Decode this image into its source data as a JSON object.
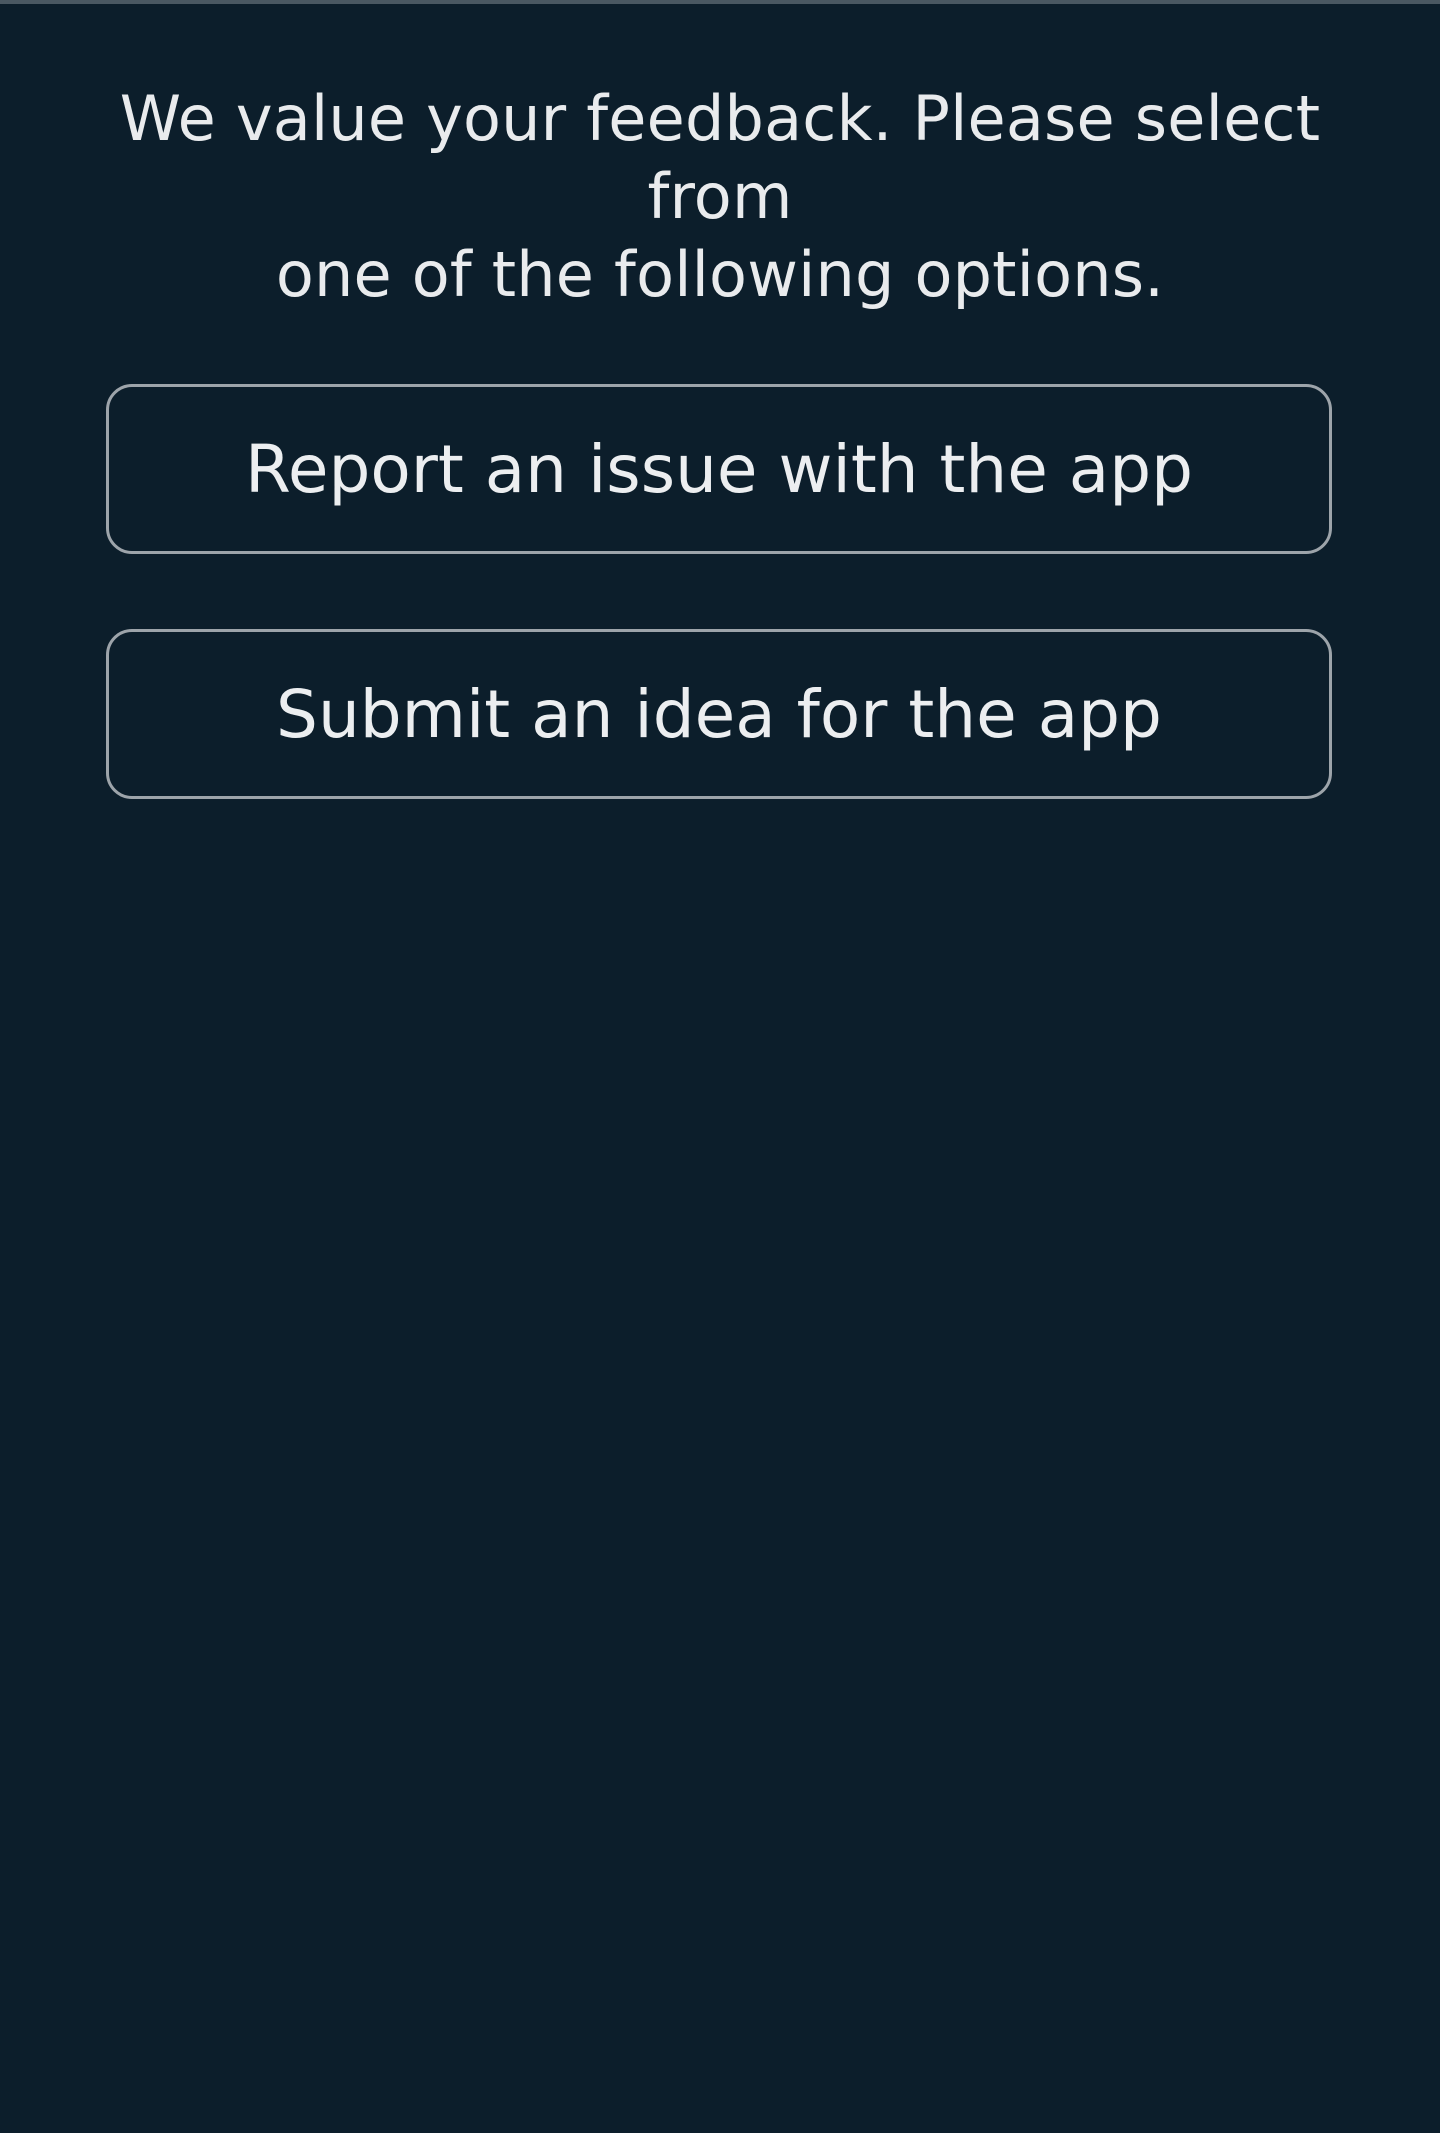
{
  "prompt": {
    "line1": "We value your feedback. Please select from",
    "line2": "one of the following options."
  },
  "options": [
    {
      "label": "Report an issue with the app"
    },
    {
      "label": "Submit an idea for the app"
    }
  ],
  "colors": {
    "background": "#0c1e2b",
    "text": "#e9ebed",
    "button_border": "#9da4aa"
  }
}
